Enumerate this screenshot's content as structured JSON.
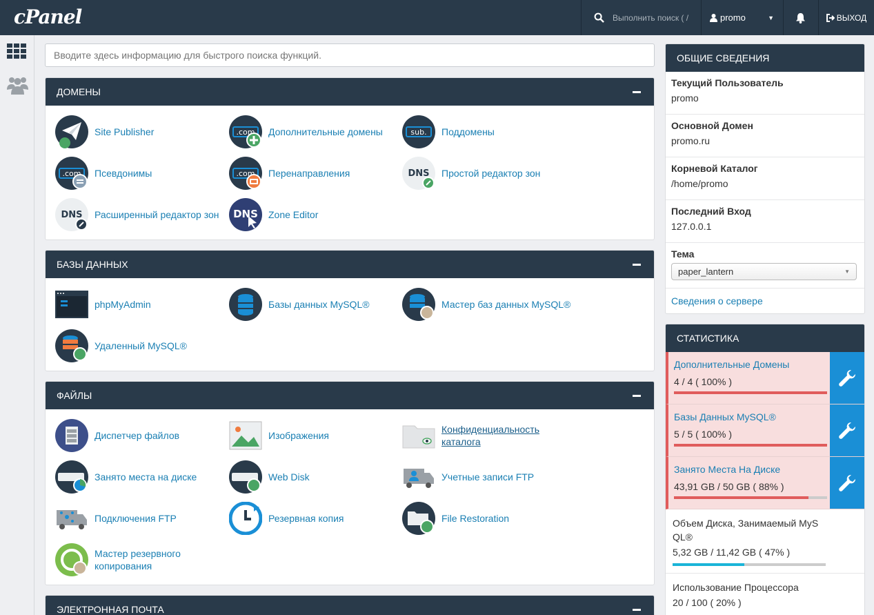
{
  "topbar": {
    "logo": "cPanel",
    "search_placeholder": "Выполнить поиск ( /",
    "user": "promo",
    "logout": "ВЫХОД"
  },
  "quick_search": {
    "placeholder": "Вводите здесь информацию для быстрого поиска функций."
  },
  "domains": {
    "title": "ДОМЕНЫ",
    "items": [
      "Site Publisher",
      "Дополнительные домены",
      "Поддомены",
      "Псевдонимы",
      "Перенаправления",
      "Простой редактор зон",
      "Расширенный редактор зон",
      "Zone Editor"
    ]
  },
  "databases": {
    "title": "БАЗЫ ДАННЫХ",
    "items": [
      "phpMyAdmin",
      "Базы данных MySQL®",
      "Мастер баз данных MySQL®",
      "Удаленный MySQL®"
    ]
  },
  "files": {
    "title": "ФАЙЛЫ",
    "items": [
      "Диспетчер файлов",
      "Изображения",
      "Конфиденциальность каталога",
      "Занято места на диске",
      "Web Disk",
      "Учетные записи FTP",
      "Подключения FTP",
      "Резервная копия",
      "File Restoration",
      "Мастер резервного копирования"
    ]
  },
  "email": {
    "title": "ЭЛЕКТРОННАЯ ПОЧТА"
  },
  "general": {
    "title": "ОБЩИЕ СВЕДЕНИЯ",
    "current_user_label": "Текущий Пользователь",
    "current_user": "promo",
    "main_domain_label": "Основной Домен",
    "main_domain": "promo.ru",
    "root_label": "Корневой Каталог",
    "root": "/home/promo",
    "last_login_label": "Последний Вход",
    "last_login": "127.0.0.1",
    "theme_label": "Тема",
    "theme": "paper_lantern",
    "server_info": "Сведения о сервере"
  },
  "stats": {
    "title": "СТАТИСТИКА",
    "items": [
      {
        "label": "Дополнительные Домены",
        "value": "4 / 4 ( 100% )",
        "percent": 100
      },
      {
        "label": "Базы Данных MySQL®",
        "value": "5 / 5 ( 100% )",
        "percent": 100
      },
      {
        "label": "Занято Места На Диске",
        "value": "43,91 GB / 50 GB ( 88% )",
        "percent": 88
      },
      {
        "label": "Объем Диска, Занимаемый MySQL®",
        "value": "5,32 GB / 11,42 GB ( 47% )",
        "percent": 47
      },
      {
        "label": "Использование Процессора",
        "value": "20 / 100 ( 20% )",
        "percent": 20
      }
    ]
  },
  "colors": {
    "header": "#293a4a",
    "link": "#1a7fb3",
    "warn": "#e05c5c",
    "wrench": "#1a8fd6"
  }
}
